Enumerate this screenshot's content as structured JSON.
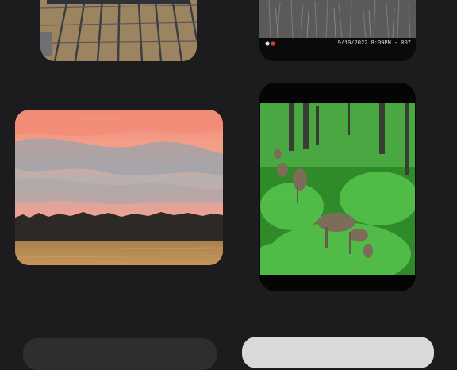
{
  "gallery": {
    "photos": [
      {
        "id_label": "trailer-grate-photo"
      },
      {
        "id_label": "night-trailcam-photo",
        "timestamp": "9/10/2022  8:09PM - 007"
      },
      {
        "id_label": "sunset-field-photo"
      },
      {
        "id_label": "deer-trailcam-photo"
      },
      {
        "id_label": "partial-photo-bottom-left"
      },
      {
        "id_label": "partial-photo-bottom-right"
      }
    ]
  },
  "colors": {
    "background": "#1c1c1e",
    "sunset_pink": "#f28a7a",
    "foliage_green": "#3fae3a",
    "field_gold": "#b98a4e"
  }
}
